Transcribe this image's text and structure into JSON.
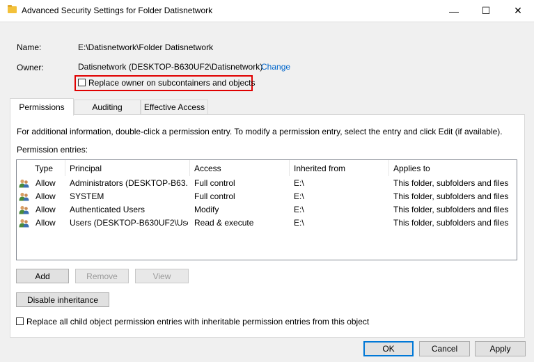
{
  "window": {
    "title": "Advanced Security Settings for Folder Datisnetwork",
    "minimize_glyph": "—",
    "maximize_glyph": "☐",
    "close_glyph": "✕"
  },
  "name_label": "Name:",
  "name_value": "E:\\Datisnetwork\\Folder Datisnetwork",
  "owner_label": "Owner:",
  "owner_value": "Datisnetwork (DESKTOP-B630UF2\\Datisnetwork)",
  "owner_change": "Change",
  "replace_owner_label": "Replace owner on subcontainers and objects",
  "tabs": [
    {
      "label": "Permissions",
      "active": true
    },
    {
      "label": "Auditing",
      "active": false
    },
    {
      "label": "Effective Access",
      "active": false
    }
  ],
  "info_text": "For additional information, double-click a permission entry. To modify a permission entry, select the entry and click Edit (if available).",
  "entries_label": "Permission entries:",
  "columns": [
    "Type",
    "Principal",
    "Access",
    "Inherited from",
    "Applies to"
  ],
  "rows": [
    {
      "type": "Allow",
      "principal": "Administrators (DESKTOP-B63...",
      "access": "Full control",
      "inherited": "E:\\",
      "applies": "This folder, subfolders and files"
    },
    {
      "type": "Allow",
      "principal": "SYSTEM",
      "access": "Full control",
      "inherited": "E:\\",
      "applies": "This folder, subfolders and files"
    },
    {
      "type": "Allow",
      "principal": "Authenticated Users",
      "access": "Modify",
      "inherited": "E:\\",
      "applies": "This folder, subfolders and files"
    },
    {
      "type": "Allow",
      "principal": "Users (DESKTOP-B630UF2\\Use...",
      "access": "Read & execute",
      "inherited": "E:\\",
      "applies": "This folder, subfolders and files"
    }
  ],
  "buttons": {
    "add": "Add",
    "remove": "Remove",
    "view": "View",
    "disable_inheritance": "Disable inheritance",
    "ok": "OK",
    "cancel": "Cancel",
    "apply": "Apply"
  },
  "replace_child_label": "Replace all child object permission entries with inheritable permission entries from this object",
  "colors": {
    "highlight": "#e00000",
    "link": "#0066cc",
    "default_button_border": "#0078d7"
  }
}
